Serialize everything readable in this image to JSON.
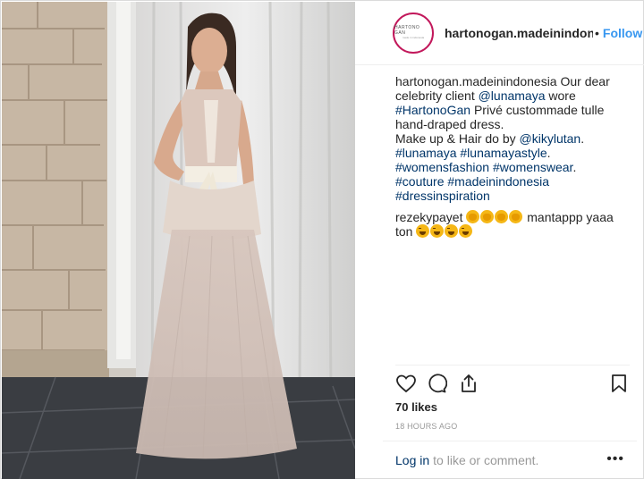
{
  "header": {
    "avatar_brand": "HARTONO GAN",
    "avatar_sub": "made in indonesia",
    "username": "hartonogan.madeinindonesia",
    "separator": "•",
    "follow_label": "Follow"
  },
  "caption": {
    "username": "hartonogan.madeinindonesia",
    "text_1": " Our dear celebrity client ",
    "mention_1": "@lunamaya",
    "text_2": " wore ",
    "hashtag_1": "#HartonoGan",
    "text_3": " Privé custommade tulle hand-draped dress.",
    "text_4": "Make up & Hair do by ",
    "mention_2": "@kikylutan",
    "text_5": ".",
    "hashtag_2": "#lunamaya",
    "hashtag_3": "#lunamayastyle",
    "text_6": ".",
    "hashtag_4": "#womensfashion",
    "hashtag_5": "#womenswear",
    "text_7": ".",
    "hashtag_6": "#couture",
    "hashtag_7": "#madeinindonesia",
    "hashtag_8": "#dressinspiration"
  },
  "comment": {
    "username": "rezekypayet",
    "text": " mantappp yaaa ton "
  },
  "actions": {
    "likes": "70 likes",
    "time": "18 HOURS AGO"
  },
  "footer": {
    "login_label": "Log in",
    "prompt": "to like or comment.",
    "more": "•••"
  },
  "icons": [
    "heart-icon",
    "comment-icon",
    "share-icon",
    "bookmark-icon",
    "clap-emoji",
    "laugh-emoji"
  ],
  "colors": {
    "link": "#003569",
    "follow": "#3897f0",
    "muted": "#999999",
    "avatar_ring": "#c2185b"
  }
}
